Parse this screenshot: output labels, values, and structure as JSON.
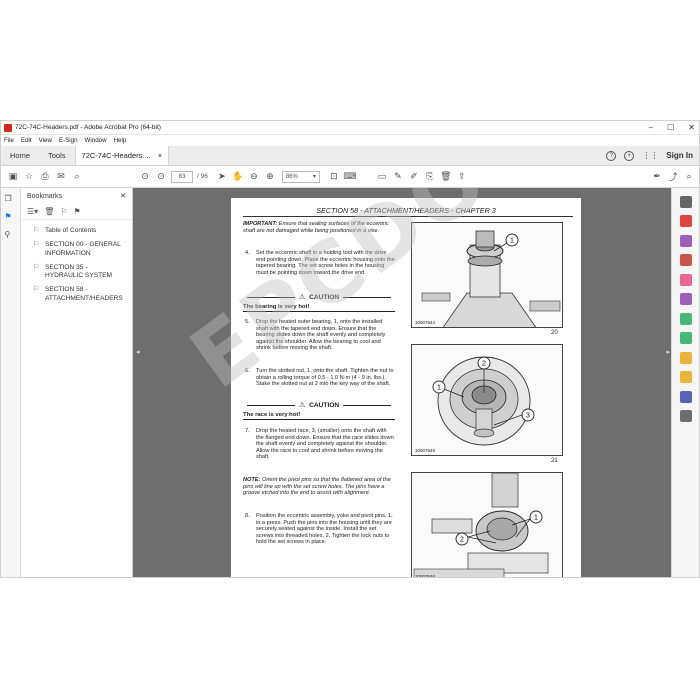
{
  "window": {
    "title": "72C-74C-Headers.pdf - Adobe Acrobat Pro (64-bit)",
    "controls": [
      "–",
      "☐",
      "✕"
    ]
  },
  "menu": [
    "File",
    "Edit",
    "View",
    "E-Sign",
    "Window",
    "Help"
  ],
  "tabs": {
    "home": "Home",
    "tools": "Tools",
    "document": "72C-74C-Headers....",
    "document_close": "×",
    "help": "?",
    "sign_in": "Sign In"
  },
  "toolbar": {
    "page_current": "83",
    "page_total": "/ 96",
    "zoom": "86%"
  },
  "bookmarks": {
    "title": "Bookmarks",
    "close": "✕",
    "items": [
      {
        "label": "Table of Contents"
      },
      {
        "label": "SECTION 00 - GENERAL INFORMATION"
      },
      {
        "label": "SECTION 35 - HYDRAULIC SYSTEM"
      },
      {
        "label": "SECTION 58 - ATTACHMENT/HEADERS"
      }
    ]
  },
  "page": {
    "section_title": "SECTION 58 - ATTACHMENT/HEADERS - CHAPTER 3",
    "important_label": "IMPORTANT:",
    "important_text": "Ensure that sealing surfaces of the eccentric shaft are not damaged while being positioned in a vise.",
    "steps": [
      {
        "num": "4.",
        "text": "Set the eccentric shaft in a holding tool with the drive end pointing down. Place the eccentric housing onto the tapered bearing. The set screw holes in the housing must be pointing down toward the drive end."
      },
      {
        "num": "5.",
        "text": "Drop the heated outer bearing, 1, onto the installed shaft with the tapered end down. Ensure that the bearing slides down the shaft evenly and completely against the shoulder. Allow the bearing to cool and shrink before moving the shaft."
      },
      {
        "num": "6.",
        "text": "Turn the slotted nut, 1, onto the shaft. Tighten the nut to obtain a rolling torque of 0.5 - 1.0 N·m (4 - 9 in. lbs.). Stake the slotted nut at 2 into the key way of the shaft."
      },
      {
        "num": "7.",
        "text": "Drop the heated race, 3, (smaller) onto the shaft with the flanged end down. Ensure that the race slides down the shaft evenly and completely against the shoulder. Allow the race to cool and shrink before moving the shaft."
      },
      {
        "num": "8.",
        "text": "Position the eccentric assembly, yoke and pivot pins, 1, in a press. Push the pins into the housing until they are securely seated against the inside. Install the set screws into threaded holes, 2. Tighten the lock nuts to hold the set screws in place."
      }
    ],
    "caution_label": "CAUTION",
    "warnings": [
      "The bearing is very hot!",
      "The race is very hot!"
    ],
    "note_label": "NOTE:",
    "note_text": "Orient the pivot pins so that the flattened area of the pins will line up with the set screw holes. The pins have a groove etched into the end to assist with alignment.",
    "figures": [
      {
        "id": "10007644",
        "number": "20",
        "callouts": [
          "1"
        ]
      },
      {
        "id": "10007645",
        "number": "21",
        "callouts": [
          "1",
          "2",
          "3"
        ]
      },
      {
        "id": "10007646",
        "number": "22",
        "callouts": [
          "1",
          "2"
        ]
      }
    ],
    "watermark": "EPCDOC.COM"
  },
  "right_tools": [
    {
      "name": "search-tool",
      "color": "#4b4b4b"
    },
    {
      "name": "create-pdf",
      "color": "#d9261c"
    },
    {
      "name": "combine-files",
      "color": "#8e44ad"
    },
    {
      "name": "organize-pages",
      "color": "#c0392b"
    },
    {
      "name": "edit-pdf",
      "color": "#e74c8c"
    },
    {
      "name": "comment",
      "color": "#8e44ad"
    },
    {
      "name": "export-pdf",
      "color": "#27ae60"
    },
    {
      "name": "send-comments",
      "color": "#27ae60"
    },
    {
      "name": "fill-sign",
      "color": "#e6a817"
    },
    {
      "name": "stamp",
      "color": "#e6a817"
    },
    {
      "name": "protect",
      "color": "#3949ab"
    },
    {
      "name": "more-tools",
      "color": "#555555"
    }
  ]
}
